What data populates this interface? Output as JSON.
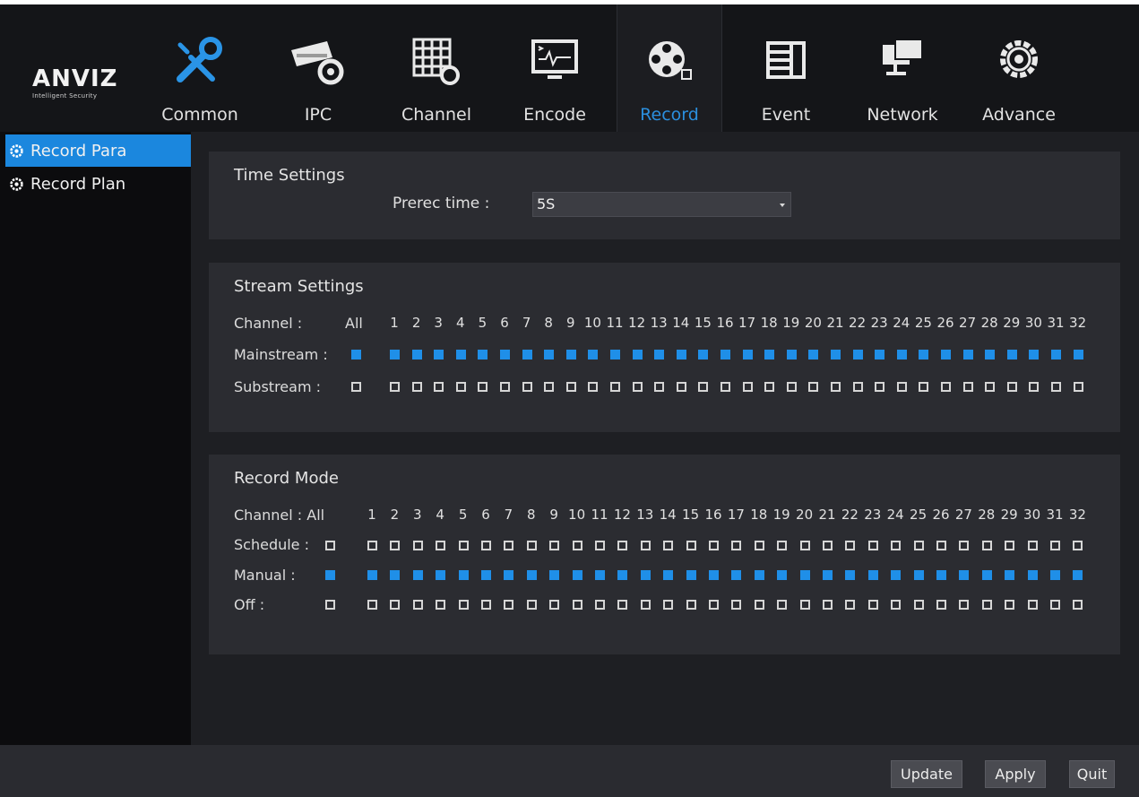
{
  "window": {
    "close_glyph": "×"
  },
  "logo": {
    "brand": "ANVIZ",
    "tagline": "Intelligent Security"
  },
  "tabs": [
    {
      "label": "Common",
      "icon": "tools-icon"
    },
    {
      "label": "IPC",
      "icon": "camera-icon"
    },
    {
      "label": "Channel",
      "icon": "channel-grid-icon"
    },
    {
      "label": "Encode",
      "icon": "encode-monitor-icon"
    },
    {
      "label": "Record",
      "icon": "film-reel-icon",
      "active": true
    },
    {
      "label": "Event",
      "icon": "event-list-icon"
    },
    {
      "label": "Network",
      "icon": "network-icon"
    },
    {
      "label": "Advance",
      "icon": "advance-gear-icon"
    }
  ],
  "sidebar": {
    "items": [
      {
        "label": "Record Para",
        "active": true
      },
      {
        "label": "Record Plan",
        "active": false
      }
    ]
  },
  "time_settings": {
    "title": "Time Settings",
    "prerec_label": "Prerec time :",
    "prerec_value": "5S"
  },
  "stream_settings": {
    "title": "Stream Settings",
    "channel_label": "Channel :",
    "all_label": "All",
    "mainstream_label": "Mainstream :",
    "substream_label": "Substream :",
    "mainstream_all": true,
    "substream_all": false
  },
  "record_mode": {
    "title": "Record Mode",
    "channel_label": "Channel : All",
    "schedule_label": "Schedule :",
    "manual_label": "Manual :",
    "off_label": "Off :",
    "schedule_all": false,
    "manual_all": true,
    "off_all": false
  },
  "channel_count": 32,
  "footer": {
    "update": "Update",
    "apply": "Apply",
    "quit": "Quit"
  },
  "colors": {
    "accent": "#1f8fe8",
    "active_tab_text": "#2b8fde",
    "sidebar_active": "#1b87de"
  }
}
